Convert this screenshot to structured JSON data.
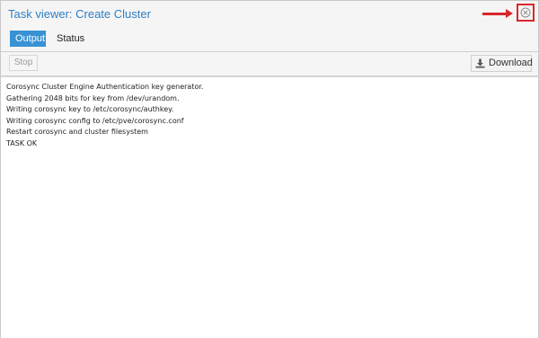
{
  "window": {
    "title": "Task viewer: Create Cluster"
  },
  "tabs": [
    {
      "label": "Output",
      "active": true
    },
    {
      "label": "Status",
      "active": false
    }
  ],
  "toolbar": {
    "stop_label": "Stop",
    "download_label": "Download"
  },
  "log": [
    "Corosync Cluster Engine Authentication key generator.",
    "Gathering 2048 bits for key from /dev/urandom.",
    "Writing corosync key to /etc/corosync/authkey.",
    "Writing corosync config to /etc/pve/corosync.conf",
    "Restart corosync and cluster filesystem",
    "TASK OK"
  ],
  "icons": {
    "close": "close-circle-icon",
    "download": "download-icon",
    "annotation": "red-arrow-icon"
  },
  "colors": {
    "title": "#2e7fc4",
    "active_tab": "#3892d4",
    "annotation": "#d9282a"
  }
}
